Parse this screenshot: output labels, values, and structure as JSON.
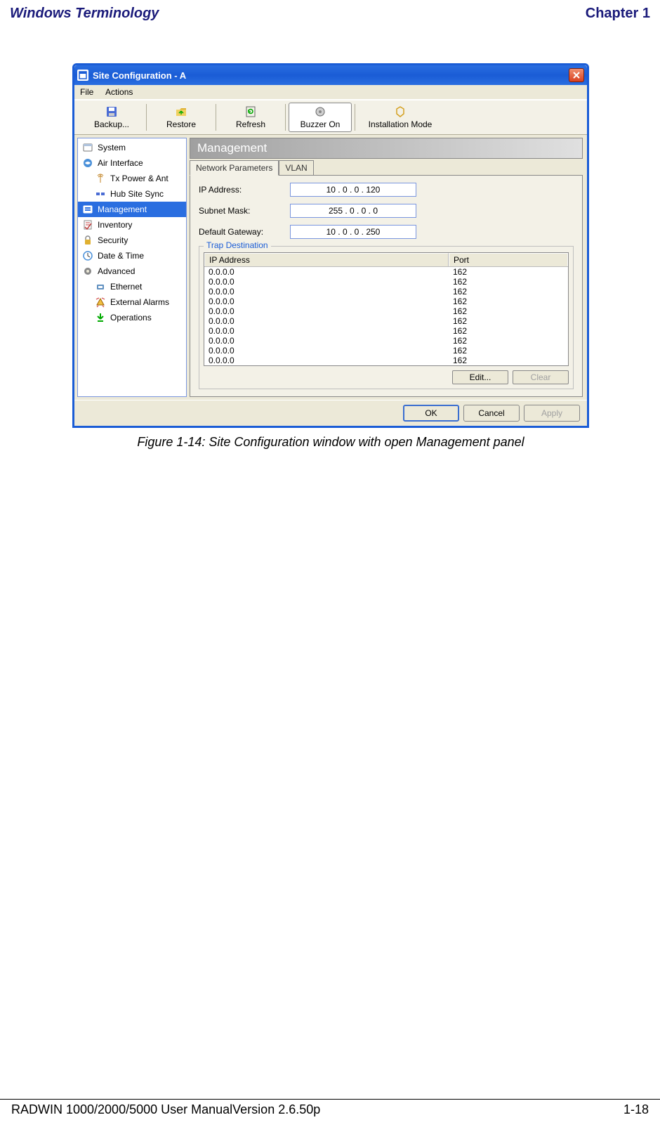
{
  "page": {
    "header_left": "Windows Terminology",
    "header_right": "Chapter 1",
    "caption": "Figure 1-14: Site Configuration window with open Management panel",
    "footer_left": "RADWIN 1000/2000/5000 User ManualVersion  2.6.50p",
    "footer_right": "1-18"
  },
  "window": {
    "title": "Site Configuration - A",
    "menu": {
      "file": "File",
      "actions": "Actions"
    },
    "toolbar": {
      "backup": "Backup...",
      "restore": "Restore",
      "refresh": "Refresh",
      "buzzer": "Buzzer On",
      "install": "Installation Mode"
    },
    "sidebar": [
      {
        "id": "system",
        "label": "System",
        "indent": false
      },
      {
        "id": "air",
        "label": "Air Interface",
        "indent": false
      },
      {
        "id": "txpower",
        "label": "Tx Power & Ant",
        "indent": true
      },
      {
        "id": "hubsite",
        "label": "Hub Site Sync",
        "indent": true
      },
      {
        "id": "management",
        "label": "Management",
        "indent": false,
        "selected": true
      },
      {
        "id": "inventory",
        "label": "Inventory",
        "indent": false
      },
      {
        "id": "security",
        "label": "Security",
        "indent": false
      },
      {
        "id": "datetime",
        "label": "Date & Time",
        "indent": false
      },
      {
        "id": "advanced",
        "label": "Advanced",
        "indent": false
      },
      {
        "id": "ethernet",
        "label": "Ethernet",
        "indent": true
      },
      {
        "id": "extalarms",
        "label": "External Alarms",
        "indent": true
      },
      {
        "id": "operations",
        "label": "Operations",
        "indent": true
      }
    ],
    "content": {
      "header": "Management",
      "tabs": {
        "netparams": "Network Parameters",
        "vlan": "VLAN"
      },
      "fields": {
        "ip_label": "IP Address:",
        "ip_value": "10  .  0  .  0  . 120",
        "subnet_label": "Subnet Mask:",
        "subnet_value": "255 .  0  .  0  .  0",
        "gw_label": "Default Gateway:",
        "gw_value": "10  .  0  .  0  . 250"
      },
      "trap": {
        "group_title": "Trap Destination",
        "col_ip": "IP Address",
        "col_port": "Port",
        "rows": [
          {
            "ip": "0.0.0.0",
            "port": "162"
          },
          {
            "ip": "0.0.0.0",
            "port": "162"
          },
          {
            "ip": "0.0.0.0",
            "port": "162"
          },
          {
            "ip": "0.0.0.0",
            "port": "162"
          },
          {
            "ip": "0.0.0.0",
            "port": "162"
          },
          {
            "ip": "0.0.0.0",
            "port": "162"
          },
          {
            "ip": "0.0.0.0",
            "port": "162"
          },
          {
            "ip": "0.0.0.0",
            "port": "162"
          },
          {
            "ip": "0.0.0.0",
            "port": "162"
          },
          {
            "ip": "0.0.0.0",
            "port": "162"
          }
        ],
        "edit_btn": "Edit...",
        "clear_btn": "Clear"
      }
    },
    "buttons": {
      "ok": "OK",
      "cancel": "Cancel",
      "apply": "Apply"
    }
  }
}
